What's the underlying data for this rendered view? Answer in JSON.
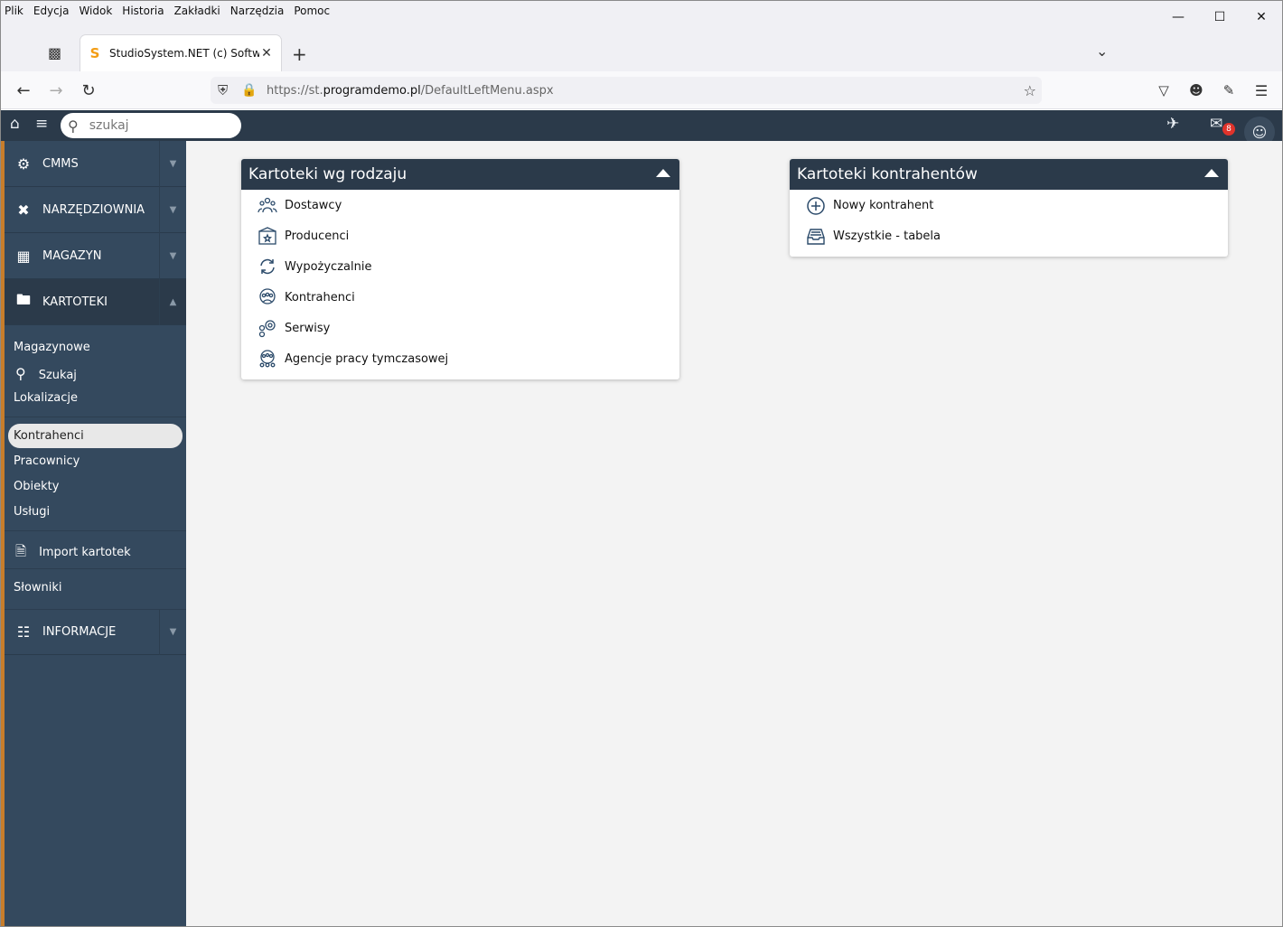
{
  "browser": {
    "menu": [
      "Plik",
      "Edycja",
      "Widok",
      "Historia",
      "Zakładki",
      "Narzędzia",
      "Pomoc"
    ],
    "tab_title": "StudioSystem.NET (c) SoftwareStudio",
    "url_prefix": "https://st.",
    "url_host": "programdemo.pl",
    "url_path": "/DefaultLeftMenu.aspx"
  },
  "appbar": {
    "search_placeholder": "szukaj",
    "mail_count": "8"
  },
  "sidebar": {
    "sections": [
      {
        "label": "CMMS",
        "icon": "gears-icon"
      },
      {
        "label": "NARZĘDZIOWNIA",
        "icon": "tools-icon"
      },
      {
        "label": "MAGAZYN",
        "icon": "warehouse-icon"
      },
      {
        "label": "KARTOTEKI",
        "icon": "folder-icon"
      },
      {
        "label": "INFORMACJE",
        "icon": "sitemap-icon"
      }
    ],
    "sub": {
      "magazynowe": "Magazynowe",
      "szukaj": "Szukaj",
      "lokalizacje": "Lokalizacje",
      "kontrahenci": "Kontrahenci",
      "pracownicy": "Pracownicy",
      "obiekty": "Obiekty",
      "uslugi": "Usługi",
      "import": "Import kartotek",
      "slowniki": "Słowniki"
    }
  },
  "panels": {
    "left": {
      "title": "Kartoteki wg rodzaju",
      "items": [
        "Dostawcy",
        "Producenci",
        "Wypożyczalnie",
        "Kontrahenci",
        "Serwisy",
        "Agencje pracy tymczasowej"
      ]
    },
    "right": {
      "title": "Kartoteki kontrahentów",
      "items": [
        "Nowy kontrahent",
        "Wszystkie - tabela"
      ]
    }
  },
  "colors": {
    "dark": "#2b3a4a",
    "sidebar": "#34495e",
    "accent": "#c77d2b",
    "badge": "#e0332b"
  }
}
